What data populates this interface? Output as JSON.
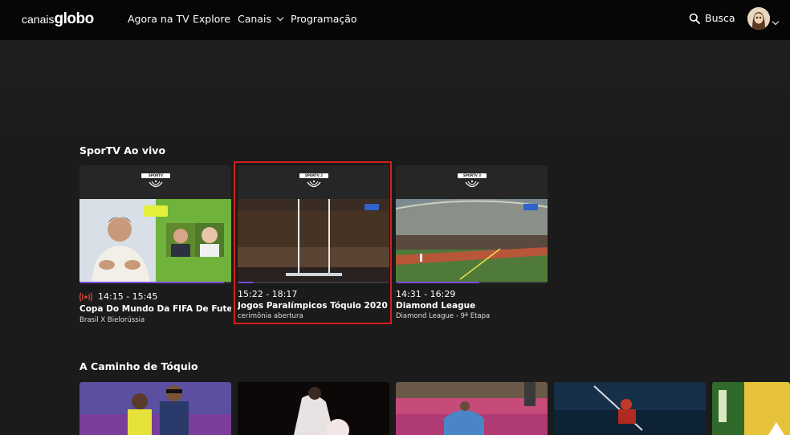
{
  "header": {
    "logo_prefix": "canais",
    "logo_main": "globo",
    "nav": [
      {
        "label": "Agora na TV"
      },
      {
        "label": "Explore"
      },
      {
        "label": "Canais"
      },
      {
        "label": "Programação"
      }
    ],
    "search_label": "Busca"
  },
  "sections": [
    {
      "title": "SporTV Ao vivo",
      "cards": [
        {
          "channel": "SPORTV",
          "time": "14:15 - 15:45",
          "title": "Copa Do Mundo Da FIFA De Futebol...",
          "subtitle": "Brasil X Bielorússia",
          "live": true,
          "progress": 0.95
        },
        {
          "channel": "SPORTV 2",
          "time": "15:22 - 18:17",
          "title": "Jogos Paralímpicos Tóquio 2020",
          "subtitle": "cerimônia abertura",
          "live": false,
          "progress": 0.1
        },
        {
          "channel": "SPORTV 3",
          "time": "14:31 - 16:29",
          "title": "Diamond League",
          "subtitle": "Diamond League - 9ª Etapa",
          "live": false,
          "progress": 0.55
        }
      ]
    },
    {
      "title": "A Caminho de Tóquio"
    }
  ],
  "colors": {
    "accent_progress": "#7a4cd9",
    "highlight": "#d61e1e",
    "live_icon": "#e0463c"
  }
}
